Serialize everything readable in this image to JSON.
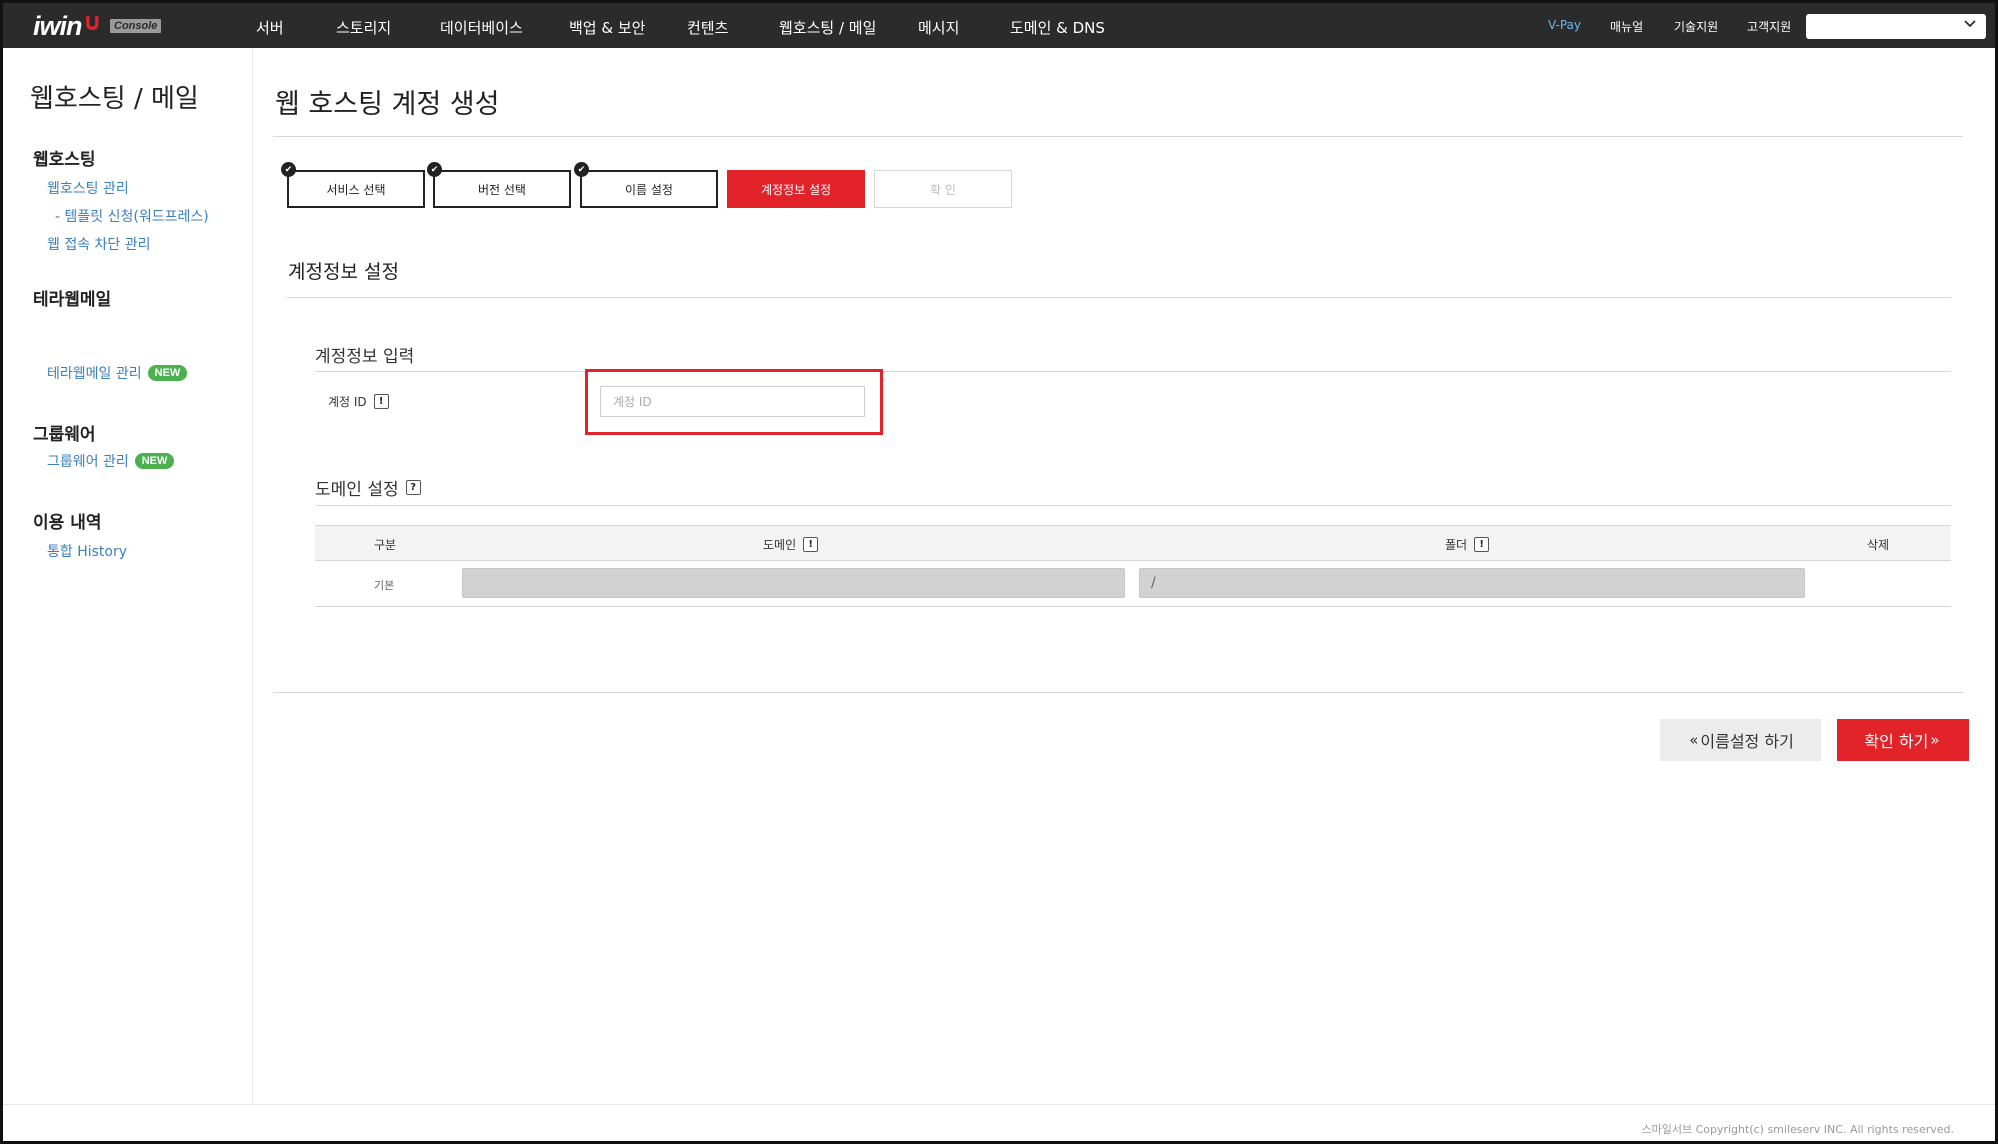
{
  "brand": {
    "name": "iwin",
    "mark": "∪",
    "badge": "Console"
  },
  "nav": {
    "items": [
      "서버",
      "스토리지",
      "데이터베이스",
      "백업 & 보안",
      "컨텐츠",
      "웹호스팅 / 메일",
      "메시지",
      "도메인 & DNS"
    ],
    "util": [
      "V-Pay",
      "매뉴얼",
      "기술지원",
      "고객지원"
    ],
    "select_value": ""
  },
  "sidebar": {
    "title": "웹호스팅 / 메일",
    "groups": [
      {
        "head": "웹호스팅",
        "links": [
          "웹호스팅 관리",
          "- 템플릿 신청(워드프레스)",
          "웹 접속 차단 관리"
        ]
      },
      {
        "head": "테라웹메일",
        "links": [
          "테라웹메일 관리"
        ],
        "badge": "NEW"
      },
      {
        "head": "그룹웨어",
        "links": [
          "그룹웨어 관리"
        ],
        "badge": "NEW"
      },
      {
        "head": "이용 내역",
        "links": [
          "통합 History"
        ]
      }
    ]
  },
  "main": {
    "title": "웹 호스팅 계정 생성",
    "steps": [
      {
        "label": "서비스 선택",
        "state": "done"
      },
      {
        "label": "버전 선택",
        "state": "done"
      },
      {
        "label": "이름 설정",
        "state": "done"
      },
      {
        "label": "계정정보 설정",
        "state": "active"
      },
      {
        "label": "확 인",
        "state": "pending"
      }
    ],
    "section_title": "계정정보 설정",
    "account": {
      "subtitle": "계정정보 입력",
      "id_label": "계정 ID",
      "id_info": "!",
      "id_placeholder": "계정 ID",
      "id_value": ""
    },
    "domain": {
      "subtitle": "도메인 설정",
      "help": "?",
      "columns": [
        "구분",
        "도메인",
        "폴더",
        "삭제"
      ],
      "column_info": "!",
      "rows": [
        {
          "type": "기본",
          "domain": "",
          "folder": "/"
        }
      ]
    },
    "buttons": {
      "prev": "이름설정 하기",
      "next": "확인 하기",
      "prev_arrow": "«",
      "next_arrow": "»"
    }
  },
  "footer": {
    "copyright": "스마일서브 Copyright(c) smileserv INC. All rights reserved."
  },
  "colors": {
    "accent": "#e2232a",
    "topbar": "#2b2b2b",
    "link": "#3a7fc0",
    "badge": "#4caf50"
  }
}
